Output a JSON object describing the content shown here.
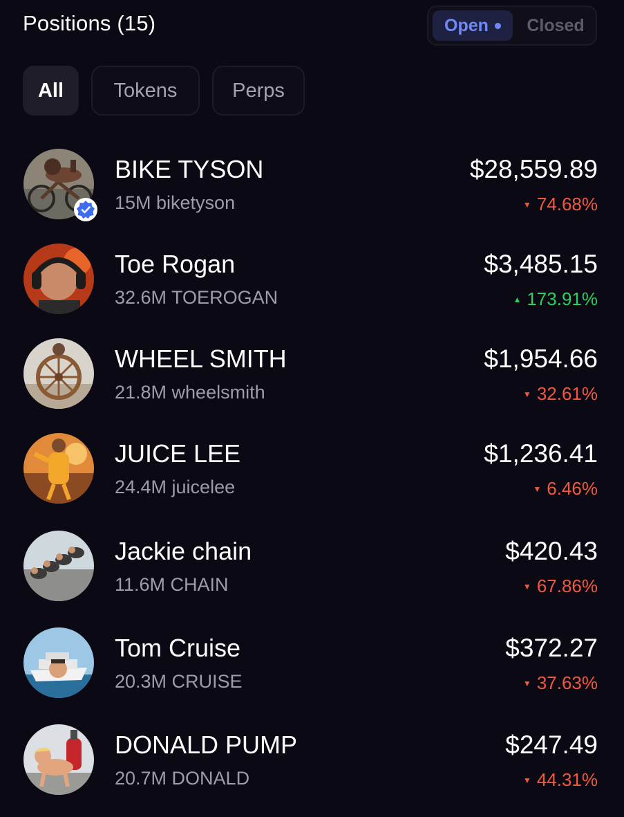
{
  "header": {
    "title": "Positions (15)",
    "toggle": {
      "open_label": "Open",
      "closed_label": "Closed",
      "selected": "Open"
    }
  },
  "filters": [
    {
      "label": "All",
      "active": true
    },
    {
      "label": "Tokens",
      "active": false
    },
    {
      "label": "Perps",
      "active": false
    }
  ],
  "colors": {
    "background": "#0b0a14",
    "accent": "#6f8af5",
    "negative": "#f2583e",
    "positive": "#2bd15c",
    "verified": "#3d6cf0"
  },
  "positions": [
    {
      "name": "BIKE TYSON",
      "holding": "15M biketyson",
      "value": "$28,559.89",
      "change": "74.68%",
      "direction": "down",
      "verified": true
    },
    {
      "name": "Toe Rogan",
      "holding": "32.6M TOEROGAN",
      "value": "$3,485.15",
      "change": "173.91%",
      "direction": "up",
      "verified": false
    },
    {
      "name": "WHEEL SMITH",
      "holding": "21.8M wheelsmith",
      "value": "$1,954.66",
      "change": "32.61%",
      "direction": "down",
      "verified": false
    },
    {
      "name": "JUICE LEE",
      "holding": "24.4M juicelee",
      "value": "$1,236.41",
      "change": "6.46%",
      "direction": "down",
      "verified": false
    },
    {
      "name": "Jackie chain",
      "holding": "11.6M CHAIN",
      "value": "$420.43",
      "change": "67.86%",
      "direction": "down",
      "verified": false
    },
    {
      "name": "Tom Cruise",
      "holding": "20.3M CRUISE",
      "value": "$372.27",
      "change": "37.63%",
      "direction": "down",
      "verified": false
    },
    {
      "name": "DONALD PUMP",
      "holding": "20.7M DONALD",
      "value": "$247.49",
      "change": "44.31%",
      "direction": "down",
      "verified": false
    }
  ]
}
